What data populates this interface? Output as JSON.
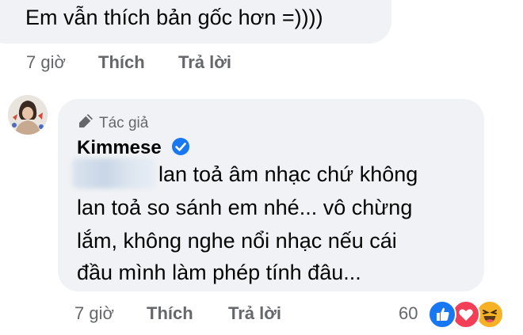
{
  "first_comment": {
    "text": "Em vẫn thích bản gốc hơn =))))",
    "time": "7 giờ",
    "like_label": "Thích",
    "reply_label": "Trả lời"
  },
  "reply_comment": {
    "author_badge": "Tác giả",
    "author_name": "Kimmese",
    "lines": [
      "lan toả âm nhạc chứ không",
      "lan toả so sánh em nhé... vô chừng",
      "lắm, không nghe nổi nhạc nếu cái",
      "đầu mình làm phép tính đâu..."
    ],
    "time": "7 giờ",
    "like_label": "Thích",
    "reply_label": "Trả lời",
    "reaction_count": "60",
    "reactions": [
      "like-icon",
      "love-icon",
      "haha-icon"
    ]
  },
  "colors": {
    "bubble": "#f0f2f5",
    "secondary_text": "#65676b",
    "verified": "#1877f2"
  }
}
